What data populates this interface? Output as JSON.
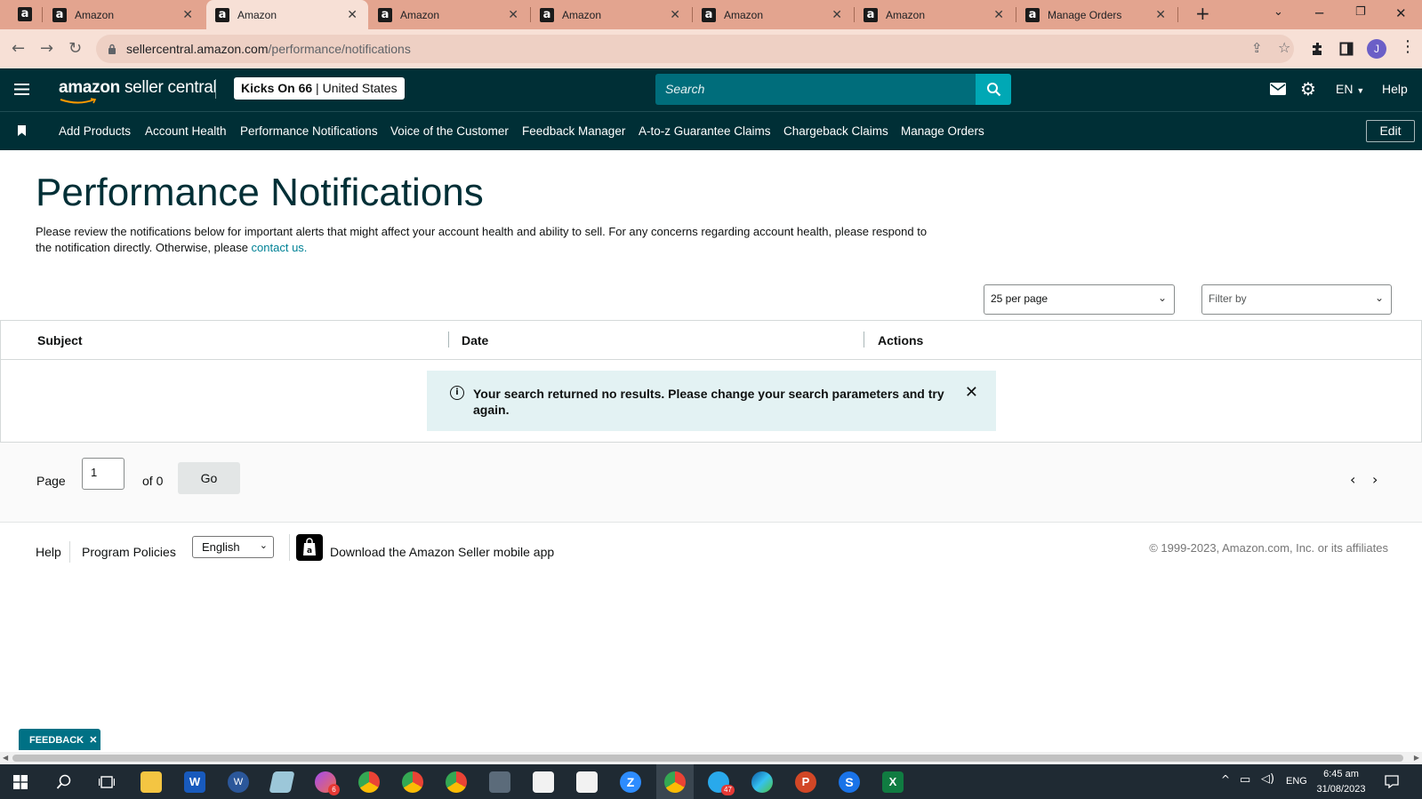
{
  "browser": {
    "tabs": [
      {
        "label": "Amazon",
        "active": false
      },
      {
        "label": "Amazon",
        "active": true
      },
      {
        "label": "Amazon",
        "active": false
      },
      {
        "label": "Amazon",
        "active": false
      },
      {
        "label": "Amazon",
        "active": false
      },
      {
        "label": "Amazon",
        "active": false
      },
      {
        "label": "Manage Orders",
        "active": false
      }
    ],
    "new_tab": "+",
    "url_host": "sellercentral.amazon.com",
    "url_path": "/performance/notifications",
    "profile_initial": "J"
  },
  "header": {
    "logo_amazon": "amazon",
    "logo_sub": "seller central",
    "store_name": "Kicks On 66",
    "marketplace": "United States",
    "search_placeholder": "Search",
    "lang": "EN",
    "help": "Help"
  },
  "nav": {
    "items": [
      "Add Products",
      "Account Health",
      "Performance Notifications",
      "Voice of the Customer",
      "Feedback Manager",
      "A-to-z Guarantee Claims",
      "Chargeback Claims",
      "Manage Orders"
    ],
    "edit": "Edit"
  },
  "main": {
    "title": "Performance Notifications",
    "intro": "Please review the notifications below for important alerts that might affect your account health and ability to sell. For any concerns regarding account health, please respond to the notification directly. Otherwise, please ",
    "intro_link": "contact us.",
    "per_page": "25 per page",
    "filter_placeholder": "Filter by",
    "columns": [
      "Subject",
      "Date",
      "Actions"
    ],
    "alert": "Your search returned no results. Please change your search parameters and try again."
  },
  "pager": {
    "page_label": "Page",
    "page_value": "1",
    "of_label": "of 0",
    "go": "Go"
  },
  "footer": {
    "help": "Help",
    "policies": "Program Policies",
    "language": "English",
    "download": "Download the Amazon Seller mobile app",
    "copyright": "© 1999-2023, Amazon.com, Inc. or its affiliates"
  },
  "feedback": "FEEDBACK",
  "taskbar": {
    "lang": "ENG",
    "time": "6:45 am",
    "date": "31/08/2023",
    "badges": {
      "chrome_profile": "6",
      "telegram": "47"
    }
  }
}
